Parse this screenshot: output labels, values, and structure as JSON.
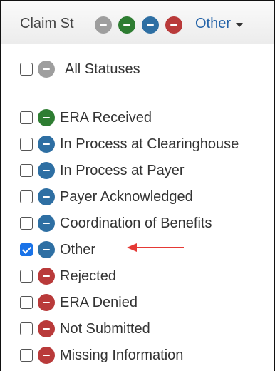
{
  "header": {
    "title": "Claim St",
    "status_dots": [
      {
        "icon": "minus-circle-icon",
        "color": "#9e9e9e"
      },
      {
        "icon": "minus-circle-icon",
        "color": "#2e7d32"
      },
      {
        "icon": "minus-circle-icon",
        "color": "#2e6fa3"
      },
      {
        "icon": "minus-circle-icon",
        "color": "#b93a3a"
      }
    ],
    "filter_label": "Other",
    "filter_color": "#2463a8"
  },
  "menu": {
    "all": {
      "label": "All Statuses",
      "checked": false,
      "color": "#9e9e9e"
    },
    "items": [
      {
        "label": "ERA Received",
        "checked": false,
        "color": "#2e7d32"
      },
      {
        "label": "In Process at Clearinghouse",
        "checked": false,
        "color": "#2e6fa3"
      },
      {
        "label": "In Process at Payer",
        "checked": false,
        "color": "#2e6fa3"
      },
      {
        "label": "Payer Acknowledged",
        "checked": false,
        "color": "#2e6fa3"
      },
      {
        "label": "Coordination of Benefits",
        "checked": false,
        "color": "#2e6fa3"
      },
      {
        "label": "Other",
        "checked": true,
        "color": "#2e6fa3"
      },
      {
        "label": "Rejected",
        "checked": false,
        "color": "#b93a3a"
      },
      {
        "label": "ERA Denied",
        "checked": false,
        "color": "#b93a3a"
      },
      {
        "label": "Not Submitted",
        "checked": false,
        "color": "#b93a3a"
      },
      {
        "label": "Missing Information",
        "checked": false,
        "color": "#b93a3a"
      }
    ]
  },
  "annotation": {
    "icon": "red-arrow-icon",
    "color": "#e53935"
  }
}
